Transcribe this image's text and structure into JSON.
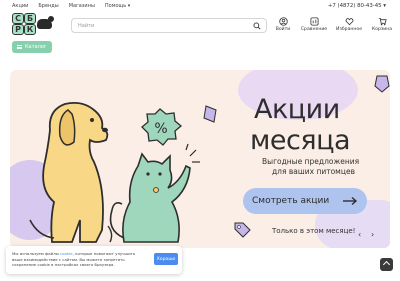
{
  "topnav": {
    "links": [
      "Акции",
      "Бренды",
      "Магазины",
      "Помощь ▾"
    ],
    "phone": "+7 (4872) 80-43-45 ▾"
  },
  "logo": {
    "letters": [
      "С",
      "Б",
      "Р",
      "К"
    ]
  },
  "search": {
    "placeholder": "Найти",
    "icon": "search-icon"
  },
  "header_actions": [
    {
      "label": "Войти",
      "icon": "user-icon"
    },
    {
      "label": "Сравнение",
      "icon": "compare-icon"
    },
    {
      "label": "Избранное",
      "icon": "heart-icon"
    },
    {
      "label": "Корзина",
      "icon": "cart-icon"
    }
  ],
  "catalog": {
    "label": "Каталог"
  },
  "banner": {
    "title_line1": "Акции",
    "title_line2": "месяца",
    "subtitle_line1": "Выгодные предложения",
    "subtitle_line2": "для ваших питомцев",
    "cta": "Смотреть акции",
    "promo": "Только в этом месяце!",
    "prev": "‹",
    "next": "›",
    "badge": "%"
  },
  "cookie": {
    "text_before_link": "Мы используем файлы ",
    "link": "cookie",
    "text_after_link": ", которые помогают улучшить ваше взаимодействие с сайтом. Вы можете запретить сохранение cookie в настройках своего браузера.",
    "button": "Хорошо"
  },
  "colors": {
    "accent": "#86d0ae",
    "banner_bg": "#fbeee6",
    "cta_bg": "#aec4ee",
    "cookie_button": "#4a8cf0"
  }
}
